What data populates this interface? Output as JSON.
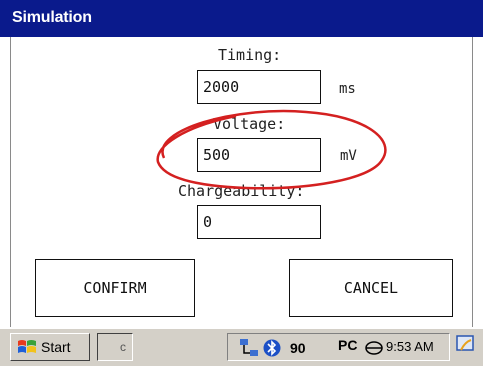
{
  "window": {
    "title": "Simulation"
  },
  "timing": {
    "label": "Timing:",
    "value": "2000",
    "unit": "ms"
  },
  "voltage": {
    "label": "Voltage:",
    "value": "500",
    "unit": "mV"
  },
  "chargeability": {
    "label": "Chargeability:",
    "value": "0"
  },
  "buttons": {
    "confirm": "CONFIRM",
    "cancel": "CANCEL"
  },
  "taskbar": {
    "start_label": "Start",
    "task_item_text": "c",
    "tray_icons": [
      "network-icon",
      "bluetooth-icon",
      "speaker-icon",
      "pc-connection-icon",
      "storage-icon"
    ],
    "pc_text": "PC",
    "clock": "9:53 AM",
    "desktop_icon": "show-desktop-icon"
  },
  "colors": {
    "titlebar": "#0a1a8c",
    "highlight": "#d42020",
    "taskbar": "#d4d0c8"
  }
}
